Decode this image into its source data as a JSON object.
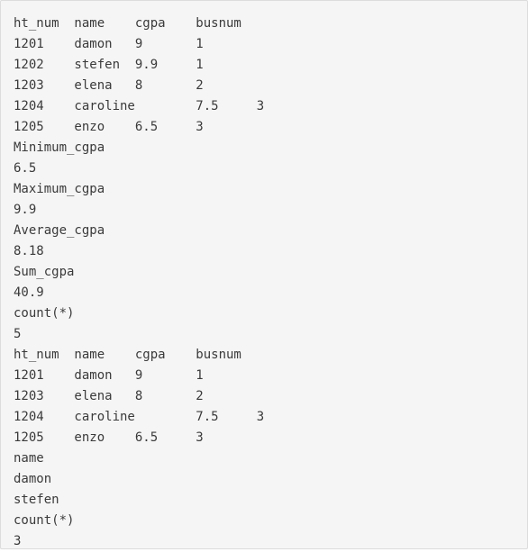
{
  "output": {
    "lines": [
      "ht_num  name    cgpa    busnum",
      "1201    damon   9       1",
      "1202    stefen  9.9     1",
      "1203    elena   8       2",
      "1204    caroline        7.5     3",
      "1205    enzo    6.5     3",
      "Minimum_cgpa",
      "6.5",
      "Maximum_cgpa",
      "9.9",
      "Average_cgpa",
      "8.18",
      "Sum_cgpa",
      "40.9",
      "count(*)",
      "5",
      "ht_num  name    cgpa    busnum",
      "1201    damon   9       1",
      "1203    elena   8       2",
      "1204    caroline        7.5     3",
      "1205    enzo    6.5     3",
      "name",
      "damon",
      "stefen",
      "count(*)",
      "3"
    ]
  }
}
